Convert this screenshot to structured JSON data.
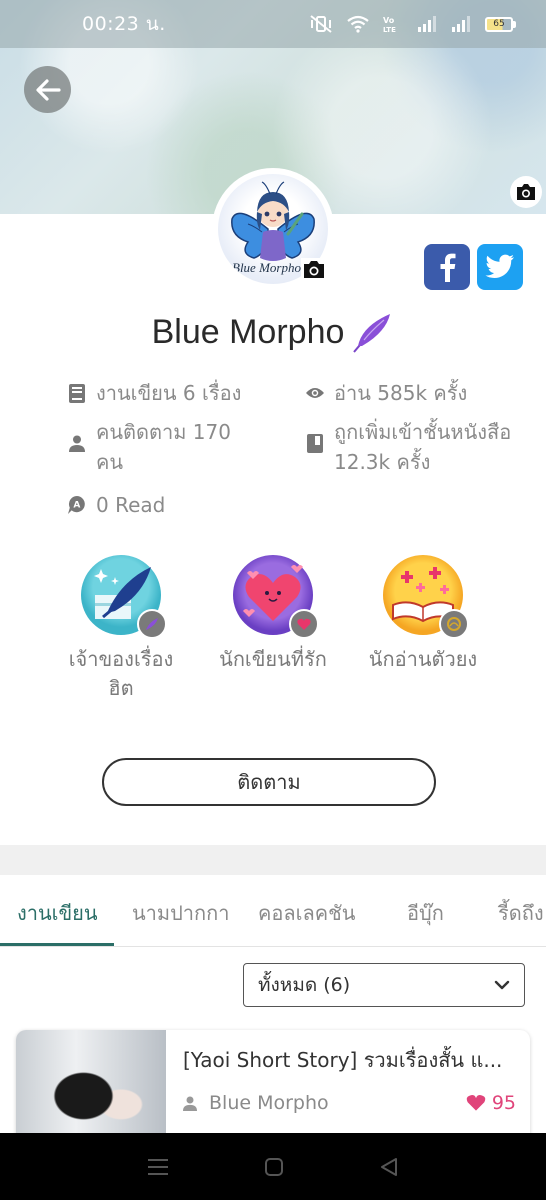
{
  "status_bar": {
    "time": "00:23 น.",
    "battery_level": "65"
  },
  "profile": {
    "name": "Blue Morpho",
    "avatar_text": "Blue Morpho"
  },
  "stats": {
    "works": "งานเขียน 6 เรื่อง",
    "reads": "อ่าน 585k ครั้ง",
    "followers_line1": "คนติดตาม 170",
    "followers_line2": "คน",
    "shelf_line1": "ถูกเพิ่มเข้าชั้นหนังสือ",
    "shelf_line2": "12.3k ครั้ง",
    "read_count": "0 Read"
  },
  "badges": [
    {
      "label_line1": "เจ้าของเรื่อง",
      "label_line2": "ฮิต",
      "icon": "quill-badge-icon"
    },
    {
      "label_line1": "นักเขียนที่รัก",
      "label_line2": "",
      "icon": "heart-badge-icon"
    },
    {
      "label_line1": "นักอ่านตัวยง",
      "label_line2": "",
      "icon": "book-badge-icon"
    }
  ],
  "follow_label": "ติดตาม",
  "tabs": [
    "งานเขียน",
    "นามปากกา",
    "คอลเลคชัน",
    "อีบุ๊ก",
    "รี้ดถึง"
  ],
  "active_tab": 0,
  "filter": {
    "selected": "ทั้งหมด (6)"
  },
  "stories": [
    {
      "title": "[Yaoi Short Story] รวมเรื่องสั้น แ...",
      "author": "Blue Morpho",
      "likes": "95"
    }
  ],
  "colors": {
    "accent": "#2b6e67",
    "facebook": "#3b5bab",
    "twitter": "#1da1f2",
    "like": "#e0447a",
    "feather": "#8a4fd8"
  }
}
